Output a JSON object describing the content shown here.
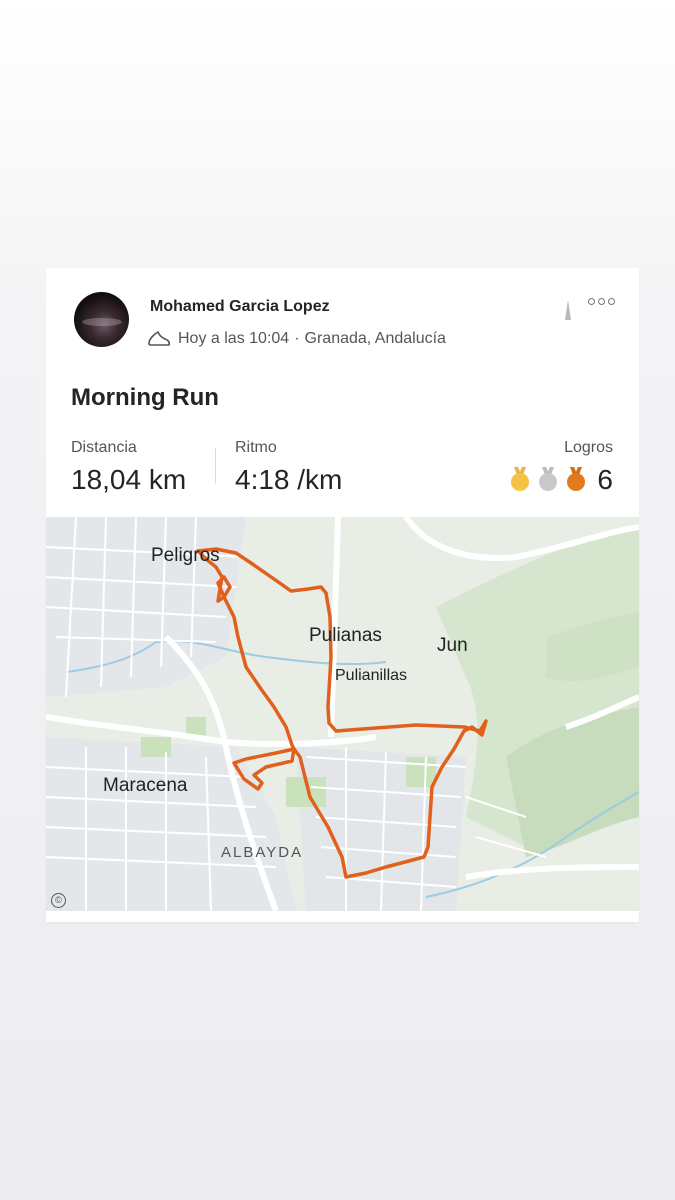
{
  "activity": {
    "user_name": "Mohamed Garcia Lopez",
    "timestamp": "Hoy a las 10:04",
    "separator": "·",
    "location": "Granada, Andalucía",
    "title": "Morning Run"
  },
  "stats": {
    "distance_label": "Distancia",
    "distance_value": "18,04 km",
    "pace_label": "Ritmo",
    "pace_value": "4:18 /km",
    "achievements_label": "Logros",
    "achievements_count": "6",
    "medal_colors": [
      "#f5c243",
      "#c9c9cc",
      "#e07a1c"
    ]
  },
  "map": {
    "labels": {
      "peligros": "Peligros",
      "pulianas": "Pulianas",
      "pulianillas": "Pulianillas",
      "jun": "Jun",
      "maracena": "Maracena",
      "albayda": "ALBAYDA"
    },
    "attribution": "©",
    "route_color": "#e0601c"
  },
  "icons": {
    "more": "more-options-icon",
    "shoe": "shoe-icon",
    "medal": "medal-icon"
  }
}
